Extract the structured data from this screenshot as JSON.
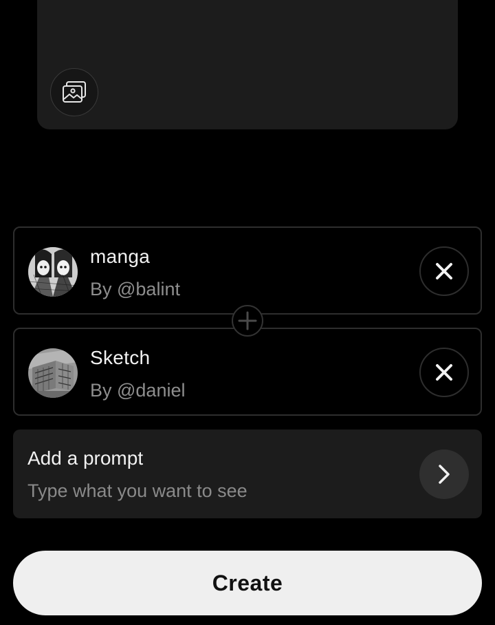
{
  "upload": {
    "icon": "image-gallery-icon"
  },
  "styles": [
    {
      "name": "manga",
      "author": "By @balint",
      "thumbnail": "manga-thumbnail",
      "remove_icon": "close-icon"
    },
    {
      "name": "Sketch",
      "author": "By @daniel",
      "thumbnail": "sketch-thumbnail",
      "remove_icon": "close-icon"
    }
  ],
  "join_icon": "plus-icon",
  "prompt": {
    "title": "Add a prompt",
    "placeholder": "Type what you want to see",
    "next_icon": "chevron-right-icon"
  },
  "create_button": {
    "label": "Create"
  },
  "colors": {
    "background": "#000000",
    "card": "#1c1c1c",
    "border": "#2e2e2e",
    "muted_text": "#8e8e8e",
    "button": "#efefef"
  }
}
